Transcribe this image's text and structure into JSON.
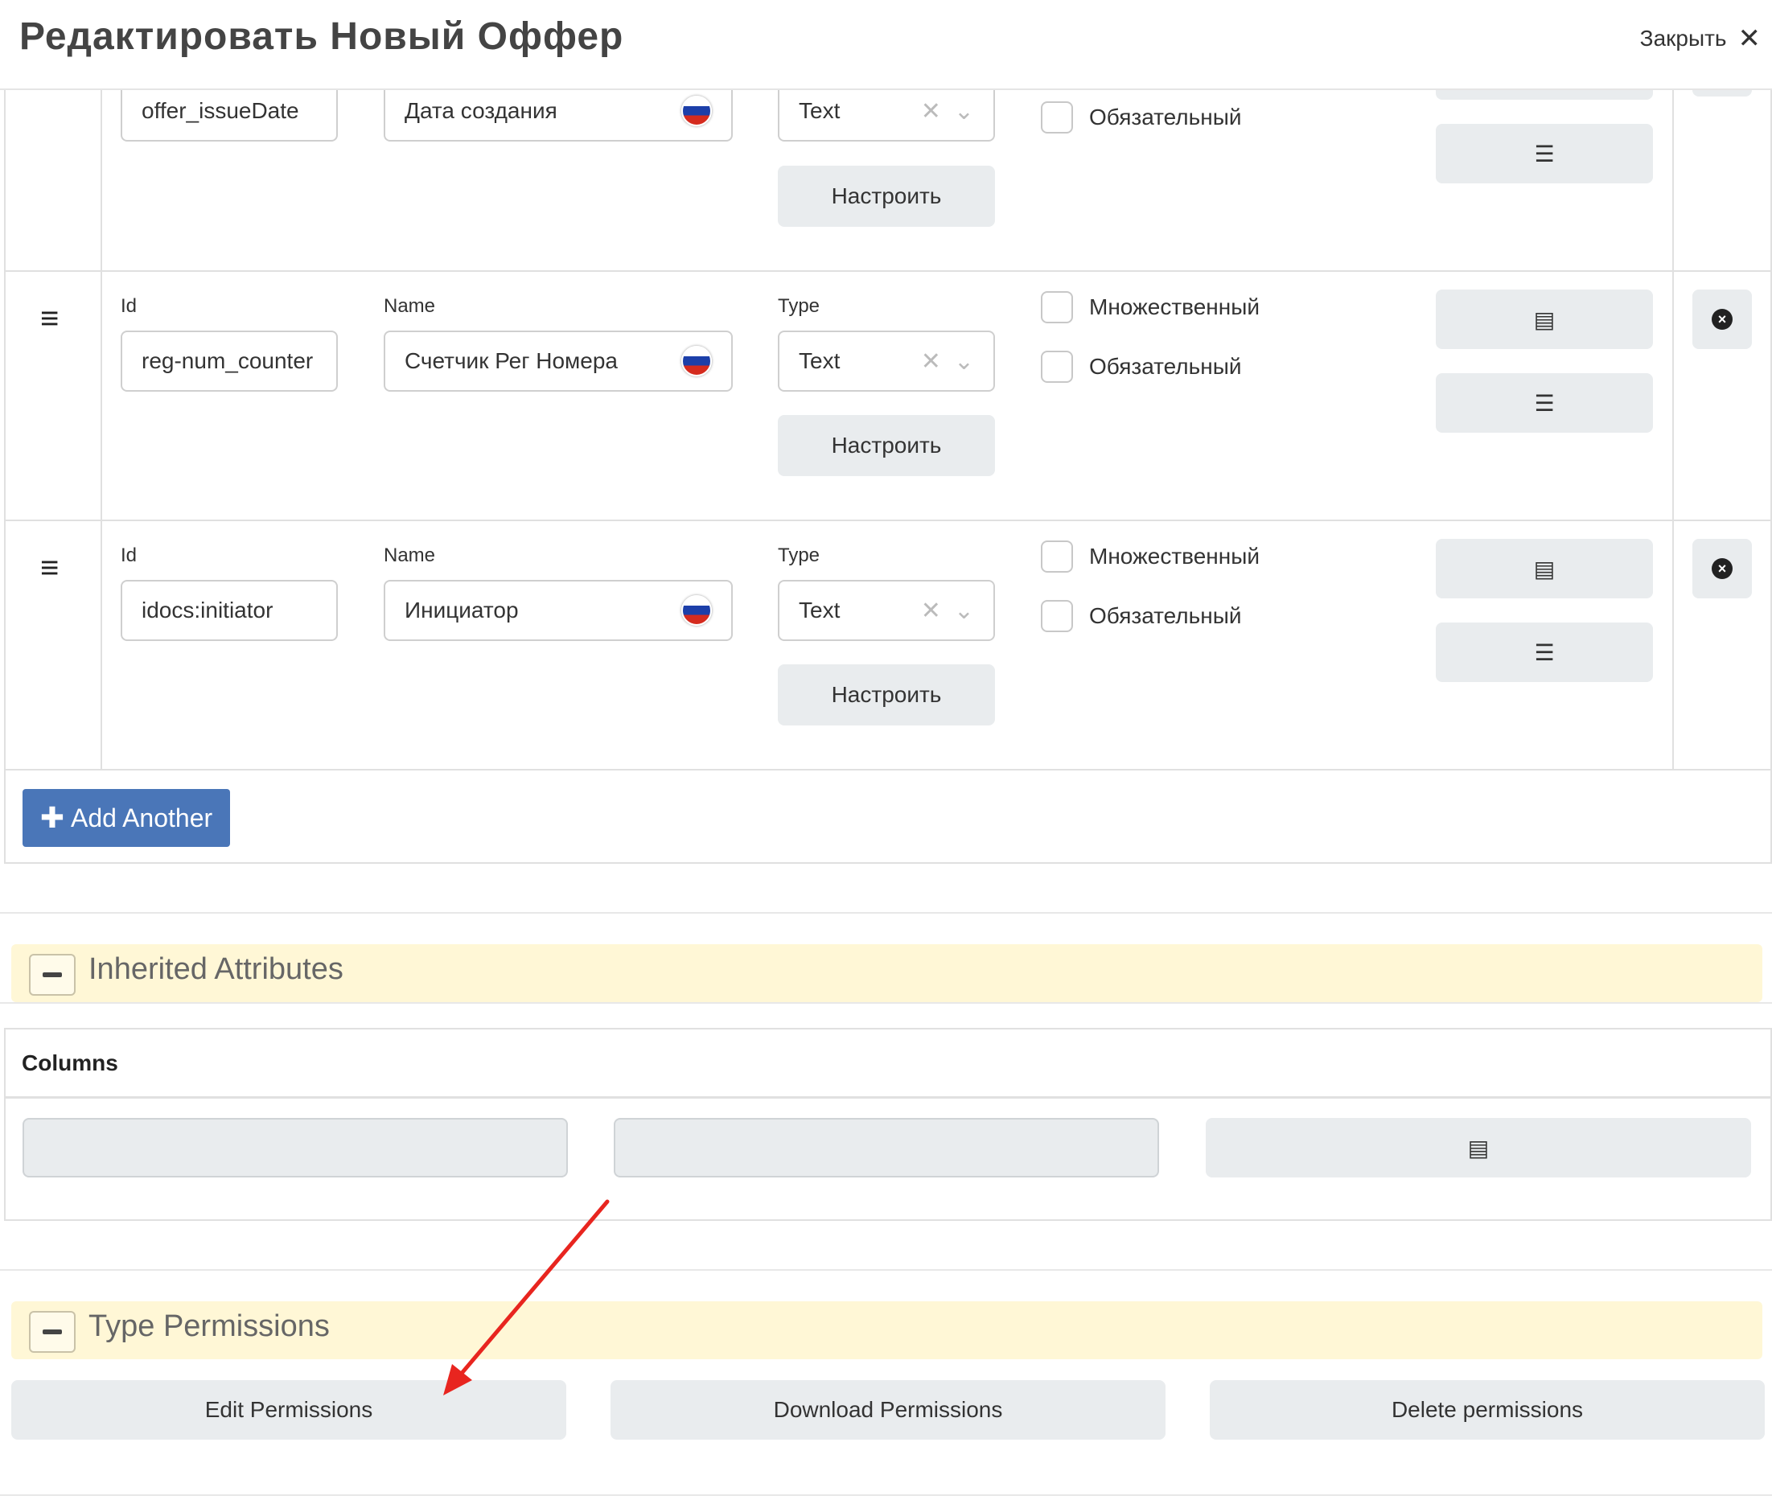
{
  "header": {
    "title": "Редактировать Новый Оффер",
    "close_label": "Закрыть",
    "close_icon": "close-icon"
  },
  "labels": {
    "id": "Id",
    "name": "Name",
    "type": "Type",
    "multiple": "Множественный",
    "required": "Обязательный",
    "configure": "Настроить"
  },
  "rows": [
    {
      "id_value": "offer_issueDate",
      "name_value": "Дата создания",
      "type_value": "Text"
    },
    {
      "id_value": "reg-num_counter",
      "name_value": "Счетчик Рег Номера",
      "type_value": "Text"
    },
    {
      "id_value": "idocs:initiator",
      "name_value": "Инициатор",
      "type_value": "Text"
    }
  ],
  "add_another_label": "Add Another",
  "inherited_attributes": {
    "title": "Inherited Attributes"
  },
  "columns": {
    "title": "Columns"
  },
  "type_permissions": {
    "title": "Type Permissions",
    "edit_label": "Edit Permissions",
    "download_label": "Download Permissions",
    "delete_label": "Delete permissions"
  },
  "colors": {
    "accent": "#4a76b8",
    "section_bg": "#fff7d6",
    "arrow": "#e8251f"
  }
}
